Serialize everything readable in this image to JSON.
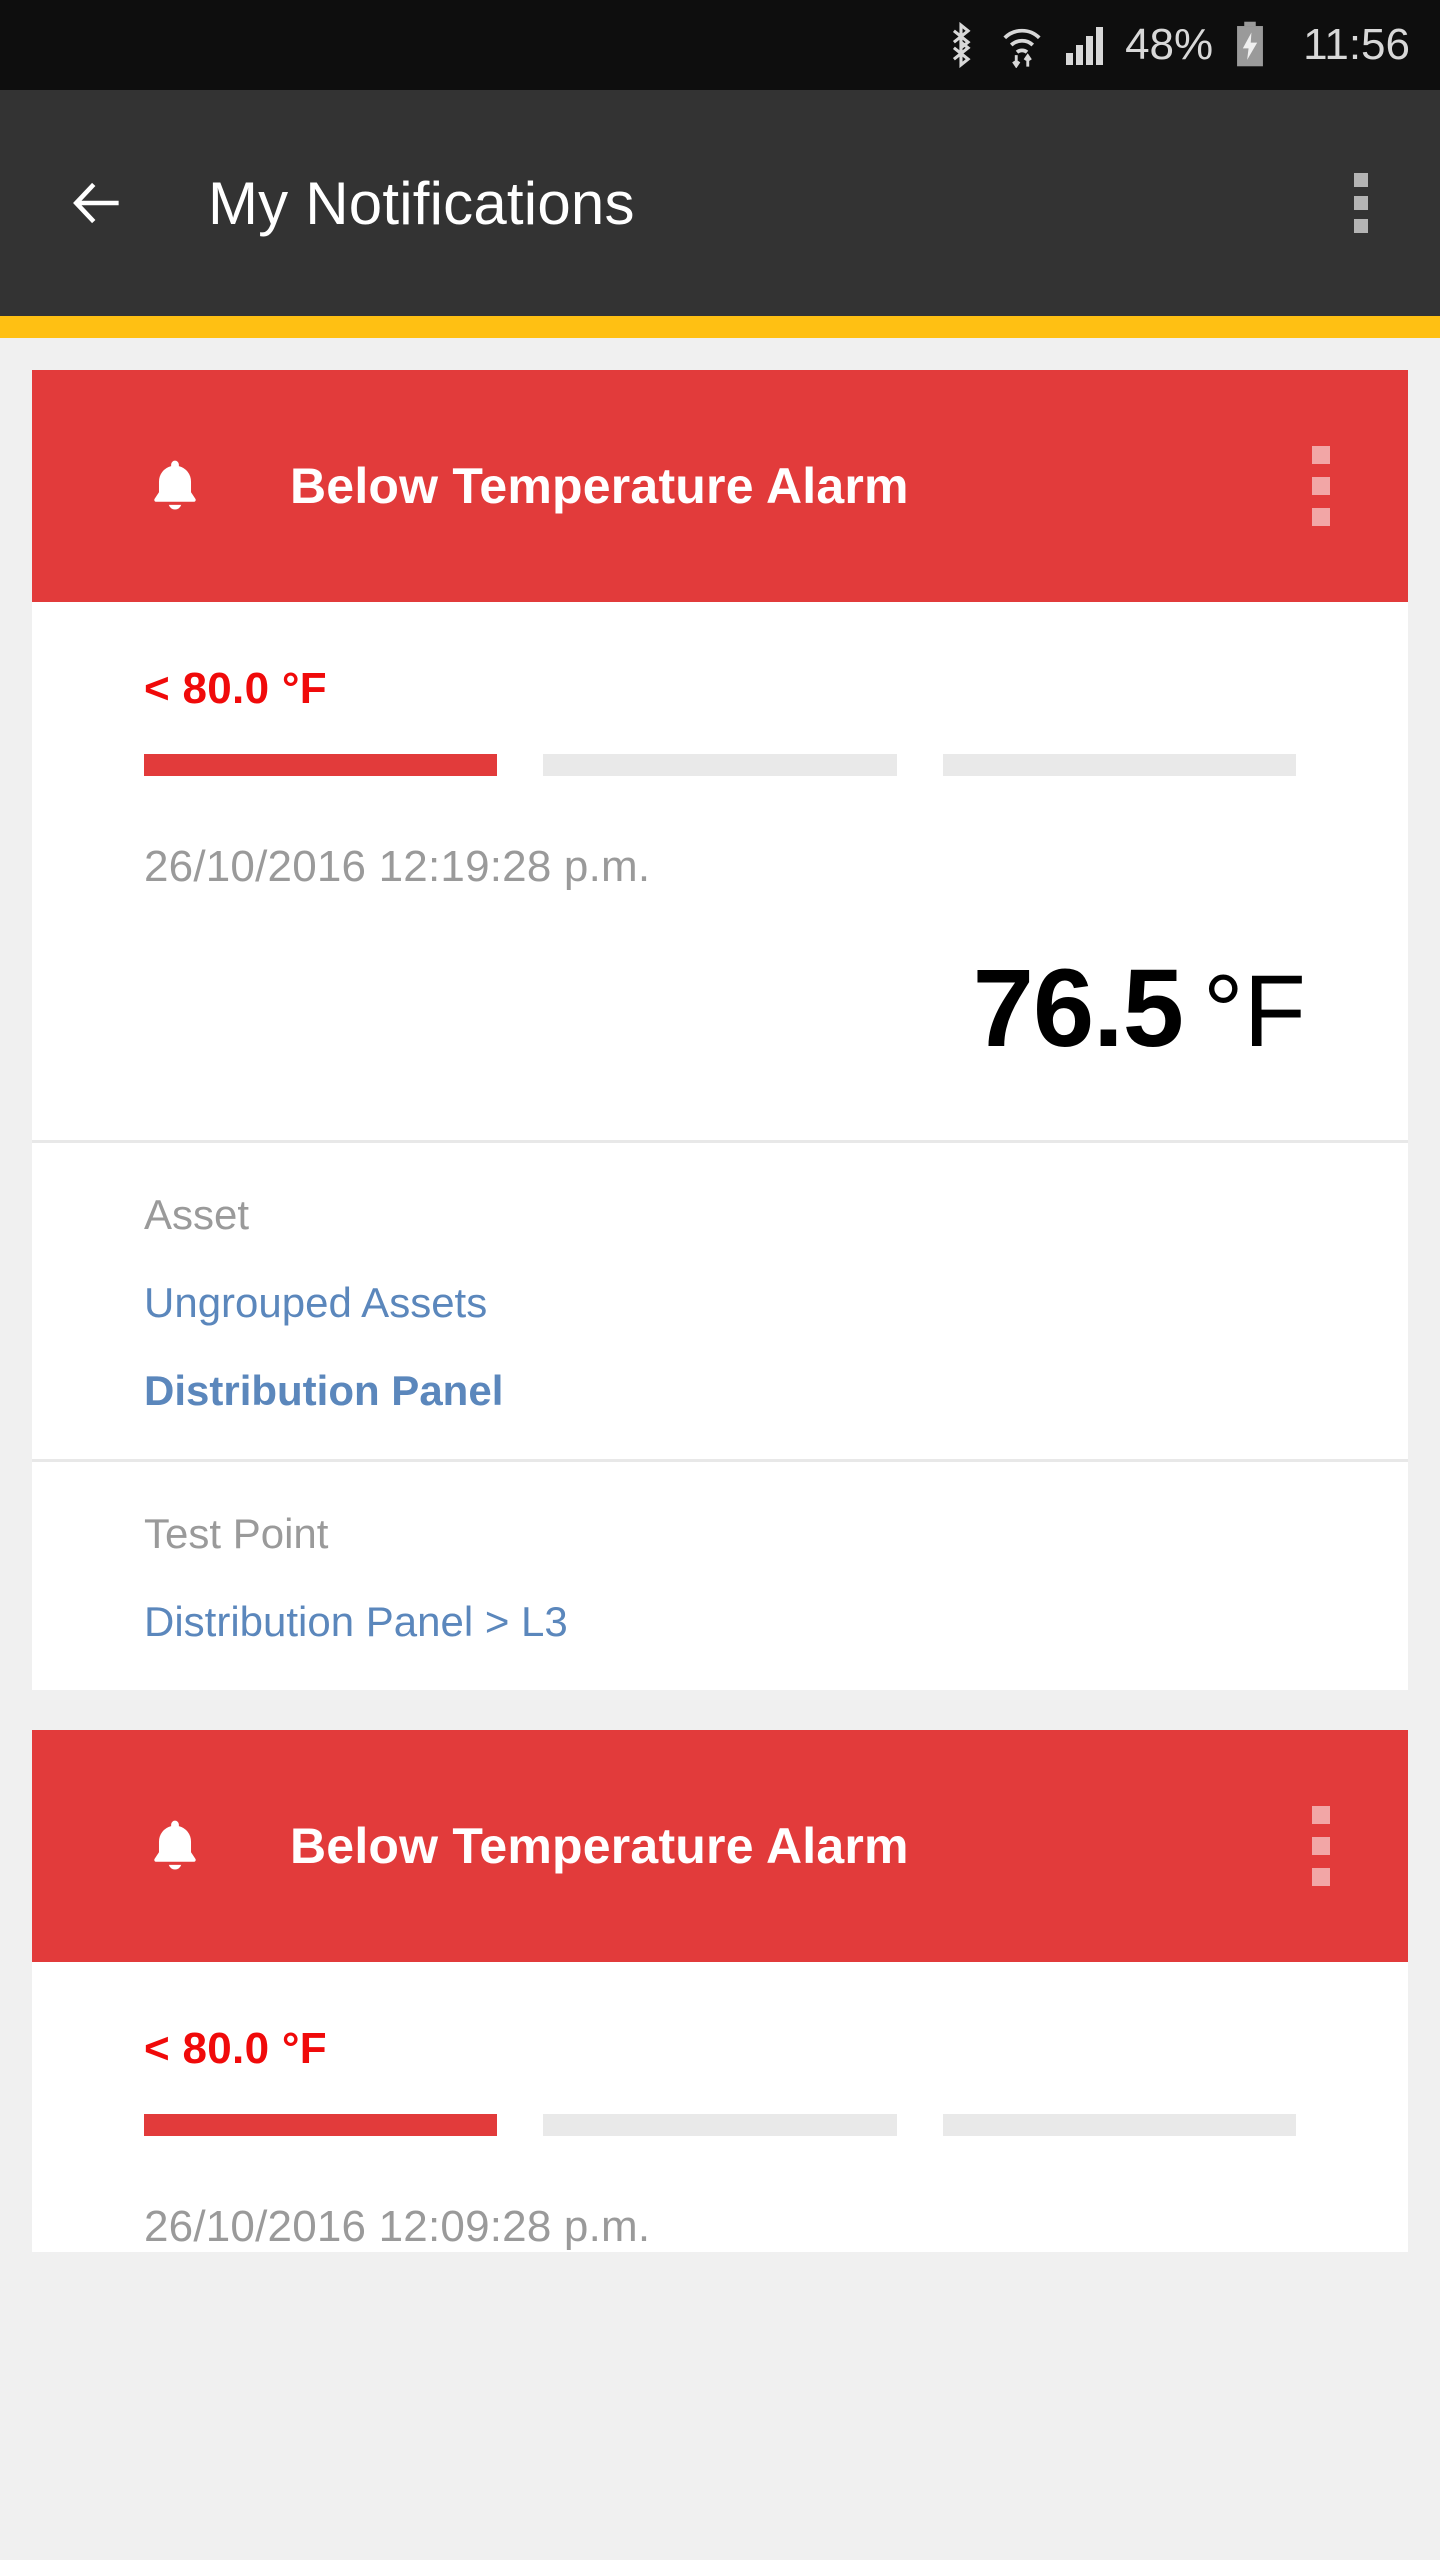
{
  "status_bar": {
    "icons": [
      "bluetooth-icon",
      "wifi-icon",
      "signal-icon",
      "battery-charging-icon"
    ],
    "battery_percent": "48%",
    "clock": "11:56"
  },
  "app_bar": {
    "back_icon": "back-arrow-icon",
    "title": "My Notifications",
    "overflow_icon": "overflow-menu-icon",
    "accent_color": "#FFC013"
  },
  "colors": {
    "alarm_red": "#E23B3B",
    "threshold_red": "#F00A0A",
    "link_blue": "#5B87BC",
    "muted_gray": "#9A9A9A",
    "segment_gray": "#E9E9E9"
  },
  "notifications": [
    {
      "icon": "bell-icon",
      "title": "Below Temperature Alarm",
      "overflow_icon": "overflow-menu-icon",
      "threshold": "< 80.0 °F",
      "segments": [
        {
          "filled": true
        },
        {
          "filled": false
        },
        {
          "filled": false
        }
      ],
      "timestamp": "26/10/2016 12:19:28 p.m.",
      "reading_value": "76.5",
      "reading_unit": "°F",
      "details": [
        {
          "label": "Asset",
          "links": [
            {
              "text": "Ungrouped Assets",
              "bold": false
            },
            {
              "text": "Distribution Panel",
              "bold": true
            }
          ]
        },
        {
          "label": "Test Point",
          "links": [
            {
              "text": "Distribution Panel > L3",
              "bold": false
            }
          ]
        }
      ]
    },
    {
      "icon": "bell-icon",
      "title": "Below Temperature Alarm",
      "overflow_icon": "overflow-menu-icon",
      "threshold": "< 80.0 °F",
      "segments": [
        {
          "filled": true
        },
        {
          "filled": false
        },
        {
          "filled": false
        }
      ],
      "timestamp": "26/10/2016 12:09:28 p.m."
    }
  ]
}
